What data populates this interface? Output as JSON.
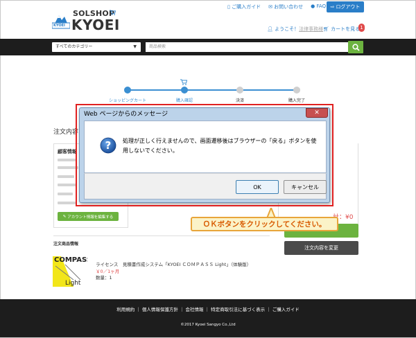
{
  "header": {
    "logo_solshop": "SOLSHOP",
    "logo_kyoei": "KYOEI",
    "logo_badge": "KYOEI",
    "top_links": [
      "ご購入ガイド",
      "お問い合わせ",
      "FAQ"
    ],
    "logout_label": "ログアウト",
    "welcome_prefix": "ようこそ！",
    "welcome_name": "法律事務様",
    "cart_label": "カートを見る",
    "cart_count": "1"
  },
  "search": {
    "category_label": "すべてのカテゴリー",
    "placeholder": "商品検索"
  },
  "steps": [
    {
      "label": "ショッピングカート",
      "active": true
    },
    {
      "label": "購入確認",
      "active": true
    },
    {
      "label": "決済",
      "active": false
    },
    {
      "label": "購入完了",
      "active": false
    }
  ],
  "main": {
    "order_title": "注文内容",
    "customer_title": "顧客情報",
    "edit_button": "アカウント情報を編集する",
    "items_label": "注文商品情報",
    "product": {
      "thumb_line1": "COMPASS",
      "thumb_line2": "Light",
      "name": "ライセンス　見積書作成システム「KYOEI ＣＯＭＰＡＳＳ Light」（体験版）",
      "price": "￥0／1ヶ月",
      "quantity": "数量：1"
    },
    "total_label": "計：¥0",
    "change_button": "注文内容を変更"
  },
  "footer": {
    "links": "利用規約 ｜ 個人情報保護方針 ｜ 会社情報 ｜ 特定商取引法に基づく表示 ｜ ご購入ガイド",
    "copyright": "©2017 Kyoei Sangyo Co.,Ltd"
  },
  "dialog": {
    "title": "Web ページからのメッセージ",
    "message": "処理が正しく行えませんので、画面遷移後はブラウザーの「戻る」ボタンを使用しないでください。",
    "ok_label": "OK",
    "cancel_label": "キャンセル"
  },
  "callout": {
    "text": "ＯＫボタンをクリックしてください。"
  },
  "colors": {
    "accent_blue": "#2a7ec8",
    "green": "#6cb33f",
    "highlight_red": "#e02020",
    "callout_orange": "#e8a53a"
  }
}
